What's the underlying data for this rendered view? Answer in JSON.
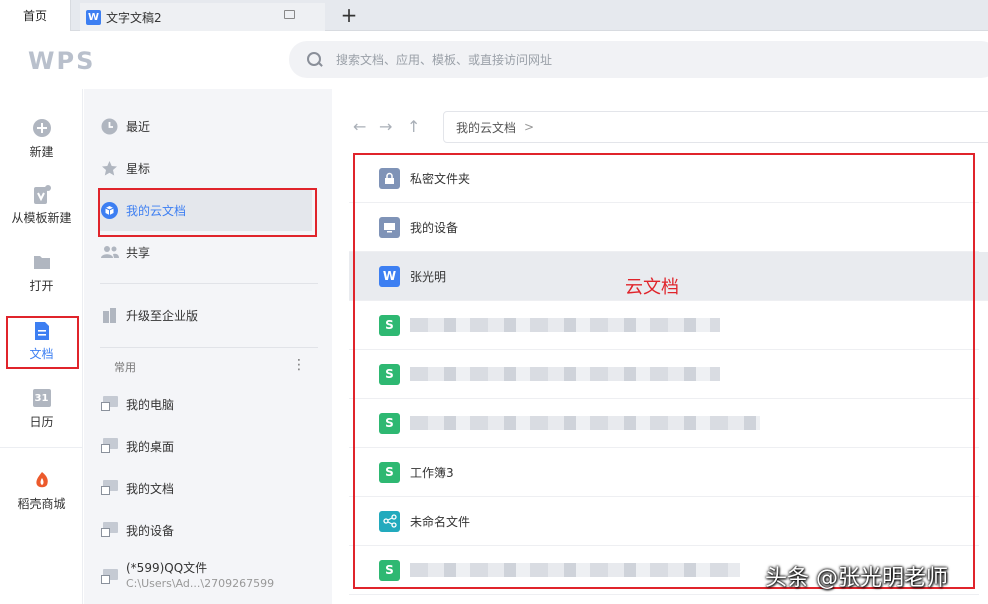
{
  "tabs": {
    "home": "首页",
    "doc": "文字文稿2",
    "add": "+"
  },
  "header": {
    "logo": "WPS",
    "search_placeholder": "搜索文档、应用、模板、或直接访问网址"
  },
  "rail": [
    {
      "label": "新建",
      "icon": "plus-circle-icon"
    },
    {
      "label": "从模板新建",
      "icon": "template-icon"
    },
    {
      "label": "打开",
      "icon": "folder-icon"
    },
    {
      "label": "文档",
      "icon": "document-icon"
    },
    {
      "label": "日历",
      "icon": "calendar-icon",
      "day": "31"
    },
    {
      "label": "稻壳商城",
      "icon": "docer-store-icon"
    }
  ],
  "nav": {
    "recent": "最近",
    "starred": "星标",
    "cloud": "我的云文档",
    "shared": "共享",
    "upgrade": "升级至企业版",
    "common_label": "常用",
    "more": "⋮",
    "common": [
      {
        "label": "我的电脑"
      },
      {
        "label": "我的桌面"
      },
      {
        "label": "我的文档"
      },
      {
        "label": "我的设备"
      },
      {
        "label": "(*599)QQ文件",
        "sub": "C:\\Users\\Ad...\\2709267599"
      }
    ]
  },
  "main": {
    "back": "←",
    "forward": "→",
    "up": "↑",
    "breadcrumb": "我的云文档",
    "breadcrumb_sep": ">",
    "files": [
      {
        "name": "私密文件夹",
        "type": "private-folder"
      },
      {
        "name": "我的设备",
        "type": "device-folder"
      },
      {
        "name": "张光明",
        "type": "word",
        "letter": "W"
      },
      {
        "name": "",
        "type": "sheet",
        "letter": "S",
        "blurred": true
      },
      {
        "name": "",
        "type": "sheet",
        "letter": "S",
        "blurred": true
      },
      {
        "name": "",
        "type": "sheet",
        "letter": "S",
        "blurred": true
      },
      {
        "name": "工作簿3",
        "type": "sheet",
        "letter": "S"
      },
      {
        "name": "未命名文件",
        "type": "share"
      },
      {
        "name": "",
        "type": "sheet",
        "letter": "S",
        "blurred": true
      }
    ],
    "annotation": "云文档"
  },
  "watermark": "头条 @张光明老师",
  "colors": {
    "accent": "#3d7ff2",
    "sheet": "#2eb872",
    "highlight": "#e0242b"
  }
}
